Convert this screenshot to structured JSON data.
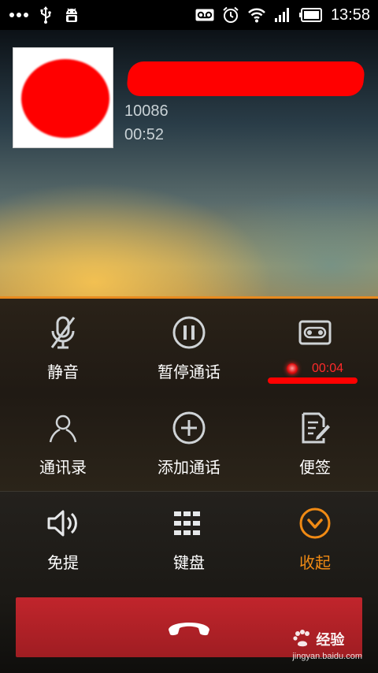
{
  "status_bar": {
    "time": "13:58",
    "left_icons": [
      "more-dots-icon",
      "usb-icon",
      "android-debug-icon"
    ],
    "right_icons": [
      "voicemail-icon",
      "alarm-icon",
      "wifi-icon",
      "signal-icon",
      "battery-icon"
    ]
  },
  "caller": {
    "number": "10086",
    "duration": "00:52"
  },
  "actions": [
    {
      "id": "mute",
      "label": "静音",
      "icon": "mic-off-icon"
    },
    {
      "id": "hold",
      "label": "暂停通话",
      "icon": "pause-icon"
    },
    {
      "id": "record",
      "label": "",
      "icon": "tape-record-icon",
      "record_time": "00:04"
    },
    {
      "id": "contacts",
      "label": "通讯录",
      "icon": "contact-person-icon"
    },
    {
      "id": "add_call",
      "label": "添加通话",
      "icon": "add-circle-icon"
    },
    {
      "id": "notes",
      "label": "便签",
      "icon": "note-edit-icon"
    }
  ],
  "controls": [
    {
      "id": "speaker",
      "label": "免提",
      "icon": "speaker-icon"
    },
    {
      "id": "keypad",
      "label": "键盘",
      "icon": "keypad-icon"
    },
    {
      "id": "collapse",
      "label": "收起",
      "icon": "chevron-down-circle-icon"
    }
  ],
  "end_call": {
    "icon": "hang-up-icon"
  },
  "watermark": {
    "brand_text": "经验",
    "url": "jingyan.baidu.com"
  },
  "colors": {
    "accent_orange": "#f08a14",
    "end_call_red": "#b0212a",
    "record_red": "#ff2a2a"
  }
}
